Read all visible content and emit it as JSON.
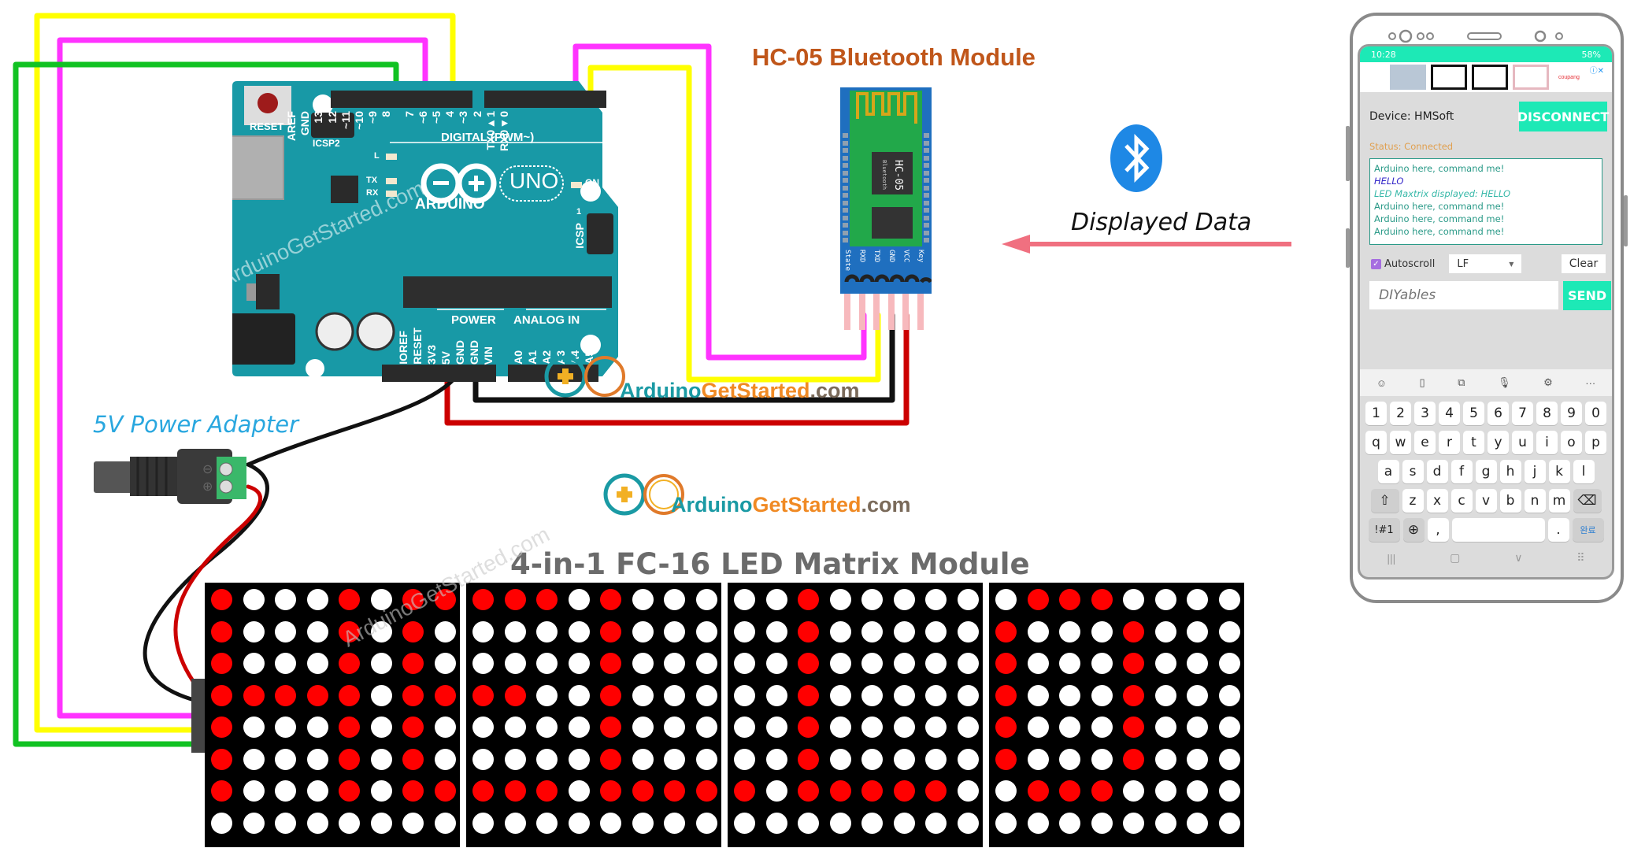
{
  "diagram": {
    "title_bt_module": "HC-05 Bluetooth Module",
    "title_matrix": "4-in-1 FC-16 LED Matrix Module",
    "label_power_adapter": "5V Power Adapter",
    "label_displayed_data": "Displayed Data",
    "watermark": "ArduinoGetStarted.com",
    "logo": {
      "part1": "Arduino",
      "part2": "GetStarted",
      "part3": ".com"
    },
    "colors": {
      "board": "#1899a6",
      "wire_yellow": "#ffff00",
      "wire_magenta": "#ff33ff",
      "wire_green": "#11c222",
      "wire_black": "#111111",
      "wire_red": "#cc0000",
      "arrow": "#f07080",
      "bt_blue": "#1e88e5",
      "title_orange": "#c0561a",
      "title_gray": "#6b6b6b",
      "led_on": "#ff0000",
      "led_off": "#ffffff",
      "phone_accent": "#1de9b6"
    }
  },
  "arduino": {
    "reset_label": "RESET",
    "icsp2_label": "ICSP2",
    "icsp_label": "ICSP",
    "icsp_pin1": "1",
    "digital_label": "DIGITAL (PWM~)",
    "brand": "ARDUINO",
    "model": "UNO",
    "on_label": "ON",
    "led_labels": [
      "L",
      "TX",
      "RX"
    ],
    "power_label": "POWER",
    "analog_label": "ANALOG IN",
    "digital_pins": [
      "AREF",
      "GND",
      "13",
      "12",
      "~11",
      "~10",
      "~9",
      "8",
      "7",
      "~6",
      "~5",
      "4",
      "~3",
      "2",
      "TX0▸1",
      "RX0◂0"
    ],
    "power_pins": [
      "IOREF",
      "RESET",
      "3V3",
      "5V",
      "GND",
      "GND",
      "VIN"
    ],
    "analog_pins": [
      "A0",
      "A1",
      "A2",
      "A3",
      "A4",
      "A5"
    ]
  },
  "hc05": {
    "chip_label": "HC-05",
    "chip_sub": "Bluetooth",
    "pins": [
      "State",
      "RXD",
      "TXD",
      "GND",
      "VCC",
      "Key"
    ]
  },
  "led_matrix": {
    "modules": [
      {
        "rows": [
          "10001011",
          "10001010",
          "10001010",
          "11111011",
          "10001010",
          "10001010",
          "10001011",
          "00000000"
        ]
      },
      {
        "rows": [
          "11101000",
          "00001000",
          "00001000",
          "11001000",
          "00001000",
          "00001000",
          "11101111",
          "00000000"
        ]
      },
      {
        "rows": [
          "00100000",
          "00100000",
          "00100000",
          "00100000",
          "00100000",
          "00100000",
          "10111110",
          "00000000"
        ]
      },
      {
        "rows": [
          "01110000",
          "10001000",
          "10001000",
          "10001000",
          "10001000",
          "10001000",
          "01110000",
          "00000000"
        ]
      }
    ]
  },
  "phone": {
    "status_time": "10:28",
    "status_right": "58%",
    "ad_label": "coupang",
    "device_label": "Device: HMSoft",
    "disconnect_label": "DISCONNECT",
    "status_text": "Status: Connected",
    "console_lines": [
      {
        "text": "Arduino here, command me!",
        "kind": "rx"
      },
      {
        "text": "HELLO",
        "kind": "tx"
      },
      {
        "text": "LED Maxtrix displayed: HELLO",
        "kind": "info"
      },
      {
        "text": "Arduino here, command me!",
        "kind": "rx"
      },
      {
        "text": "Arduino here, command me!",
        "kind": "rx"
      },
      {
        "text": "Arduino here, command me!",
        "kind": "rx"
      }
    ],
    "autoscroll_label": "Autoscroll",
    "autoscroll_checked": true,
    "line_ending": "LF",
    "clear_label": "Clear",
    "input_placeholder": "DIYables",
    "send_label": "SEND",
    "keyboard": {
      "tools": [
        "☺",
        "▯",
        "⧉",
        "🎙",
        "⚙",
        "···"
      ],
      "row1": [
        "1",
        "2",
        "3",
        "4",
        "5",
        "6",
        "7",
        "8",
        "9",
        "0"
      ],
      "row2": [
        "q",
        "w",
        "e",
        "r",
        "t",
        "y",
        "u",
        "i",
        "o",
        "p"
      ],
      "row3": [
        "a",
        "s",
        "d",
        "f",
        "g",
        "h",
        "j",
        "k",
        "l"
      ],
      "row4": [
        "z",
        "x",
        "c",
        "v",
        "b",
        "n",
        "m"
      ],
      "shift": "⇧",
      "backspace": "⌫",
      "sym": "!#1",
      "globe": "⊕",
      "comma": ",",
      "period": ".",
      "done": "완료",
      "nav": [
        "|||",
        "▢",
        "∨",
        "⠿"
      ]
    }
  }
}
